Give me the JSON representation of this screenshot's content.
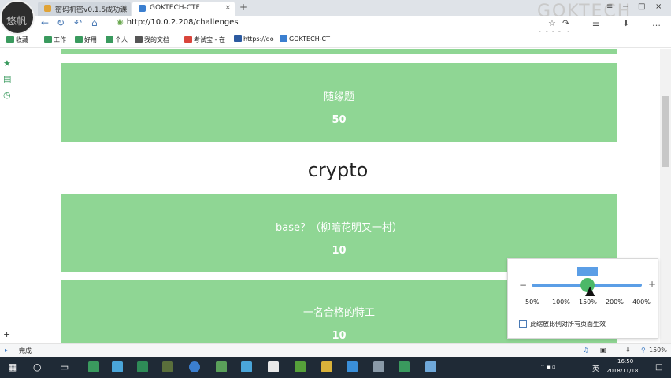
{
  "avatar": {
    "text": "悠帆"
  },
  "tabs": [
    {
      "label": "密码机密v0.1.5成功课",
      "favicon_color": "#e0a336",
      "close": "×"
    },
    {
      "label": "GOKTECH-CTF",
      "favicon_color": "#3b7fd0",
      "close": "×"
    }
  ],
  "newtab": "+",
  "watermark": "GOKTECH BIG",
  "window_controls": {
    "pin": "≡",
    "minimize": "−",
    "maximize": "□",
    "close": "×"
  },
  "nav": {
    "back": "←",
    "forward": "→",
    "reload": "↻",
    "undo": "↶",
    "home": "⌂",
    "url": "http://10.0.2.208/challenges",
    "right_icons": [
      "☆",
      "↷",
      "☰",
      "⬇",
      "…"
    ]
  },
  "bookmarks": [
    {
      "label": "收藏",
      "icon_color": "#3a9a5e"
    },
    {
      "label": "工作",
      "icon_color": "#3a9a5e"
    },
    {
      "label": "好用",
      "icon_color": "#3a9a5e"
    },
    {
      "label": "个人",
      "icon_color": "#3a9a5e"
    },
    {
      "label": "我的文档",
      "icon_color": "#555555"
    },
    {
      "label": "考试宝 - 在",
      "icon_color": "#d9453b"
    },
    {
      "label": "https://do",
      "icon_color": "#2c5aa0"
    },
    {
      "label": "GOKTECH-CT",
      "icon_color": "#3b7fd0"
    }
  ],
  "sidebar_icons": [
    "★",
    "▤",
    "◷",
    "+"
  ],
  "challenges": {
    "prev_card": {
      "title": "随缘题",
      "points": "50"
    },
    "section": "crypto",
    "cards": [
      {
        "title": "base？（柳暗花明又一村）",
        "points": "10"
      },
      {
        "title": "一名合格的特工",
        "points": "10"
      }
    ]
  },
  "zoom_popup": {
    "minus": "−",
    "plus": "+",
    "levels": [
      "50%",
      "100%",
      "150%",
      "200%",
      "400%"
    ],
    "current": "150%",
    "apply_all_label": "此缩放比例对所有页面生效",
    "accent_color": "#5b9ee6"
  },
  "statusbar": {
    "status": "完成",
    "zoom": "150%"
  },
  "taskbar": {
    "time": "16:50",
    "date": "2018/11/18",
    "lang": "英"
  },
  "colors": {
    "card": "#8fd694",
    "taskbar": "#1f2a36"
  }
}
